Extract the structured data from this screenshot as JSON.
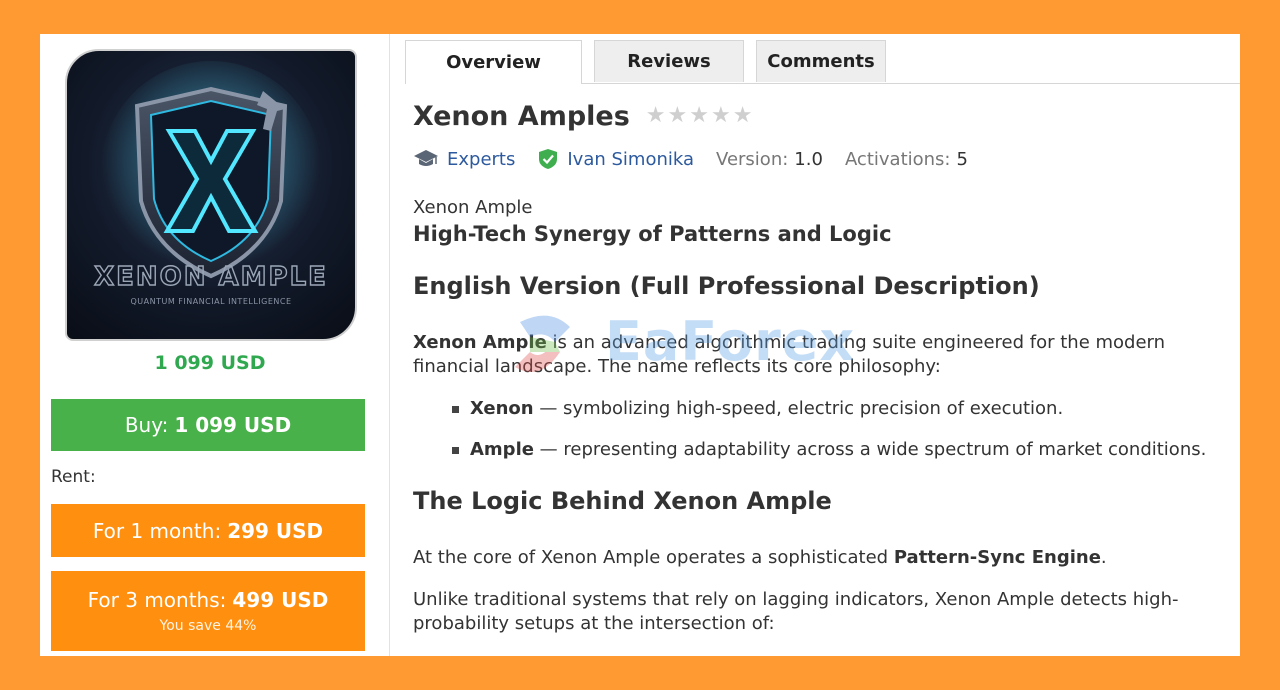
{
  "product": {
    "image_text_main": "XENON AMPLE",
    "image_text_sub": "QUANTUM FINANCIAL INTELLIGENCE",
    "price": "1 099 USD"
  },
  "buy": {
    "label": "Buy:",
    "price": "1 099 USD"
  },
  "rent": {
    "label": "Rent:",
    "options": [
      {
        "label": "For 1 month:",
        "price": "299 USD"
      },
      {
        "label": "For 3 months:",
        "price": "499 USD",
        "note": "You save 44%"
      }
    ]
  },
  "tabs": [
    {
      "label": "Overview",
      "active": true
    },
    {
      "label": "Reviews",
      "active": false
    },
    {
      "label": "Comments",
      "active": false
    }
  ],
  "header": {
    "title": "Xenon Amples",
    "rating_stars": 0,
    "rating_max": 5,
    "category": "Experts",
    "author": "Ivan Simonika",
    "version_label": "Version:",
    "version_value": "1.0",
    "activations_label": "Activations:",
    "activations_value": "5"
  },
  "description": {
    "subtitle_name": "Xenon Ample",
    "subtitle_tagline": "High-Tech Synergy of Patterns and Logic",
    "heading_1": "English Version (Full Professional Description)",
    "intro_bold": "Xenon Ample",
    "intro_text": " is an advanced algorithmic trading suite engineered for the modern financial landscape. The name reflects its core philosophy:",
    "bullets": [
      {
        "bold": "Xenon",
        "text": " — symbolizing high-speed, electric precision of execution."
      },
      {
        "bold": "Ample",
        "text": " — representing adaptability across a wide spectrum of market conditions."
      }
    ],
    "heading_2": "The Logic Behind Xenon Ample",
    "p2_text": "At the core of Xenon Ample operates a sophisticated ",
    "p2_bold": "Pattern-Sync Engine",
    "p2_end": ".",
    "p3_text": "Unlike traditional systems that rely on lagging indicators, Xenon Ample detects high-probability setups at the intersection of:"
  },
  "watermark": {
    "text": "EaForex"
  },
  "colors": {
    "page_background": "#ff9a33",
    "price_green": "#2fa84f",
    "buy_button": "#48b14a",
    "rent_button": "#ff8f0e",
    "link_blue": "#2d5a9e",
    "star_empty": "#cfcfcf"
  }
}
